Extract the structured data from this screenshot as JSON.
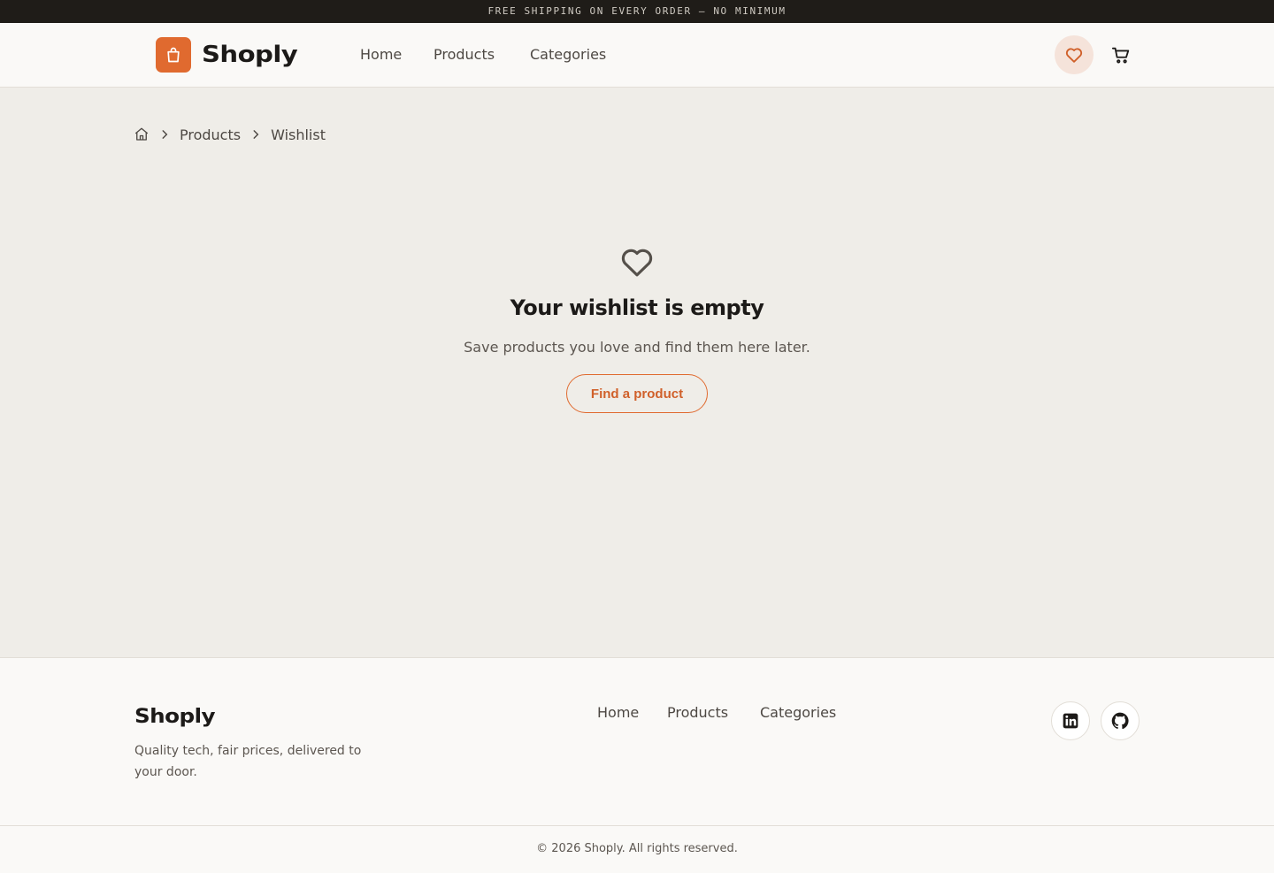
{
  "promo": {
    "text": "FREE SHIPPING ON EVERY ORDER — NO MINIMUM"
  },
  "header": {
    "logo_text": "Shoply",
    "nav": [
      "Home",
      "Products",
      "Categories"
    ],
    "wishlist_icon": "heart-icon",
    "cart_icon": "cart-icon"
  },
  "breadcrumb": {
    "home_icon": "home-icon",
    "items": [
      "Products",
      "Wishlist"
    ]
  },
  "empty_state": {
    "icon": "heart-outline-icon",
    "title": "Your wishlist is empty",
    "subtitle": "Save products you love and find them here later.",
    "cta": "Find a product"
  },
  "footer": {
    "logo_text": "Shoply",
    "tagline": "Quality tech, fair prices, delivered to your door.",
    "nav": [
      "Home",
      "Products",
      "Categories"
    ],
    "social": [
      "linkedin-icon",
      "github-icon"
    ],
    "copyright": "© 2026 Shoply. All rights reserved."
  },
  "colors": {
    "accent": "#e06a2f",
    "promo_bg": "#1f1c18",
    "page_bg": "#efede8",
    "surface": "#faf9f7"
  }
}
